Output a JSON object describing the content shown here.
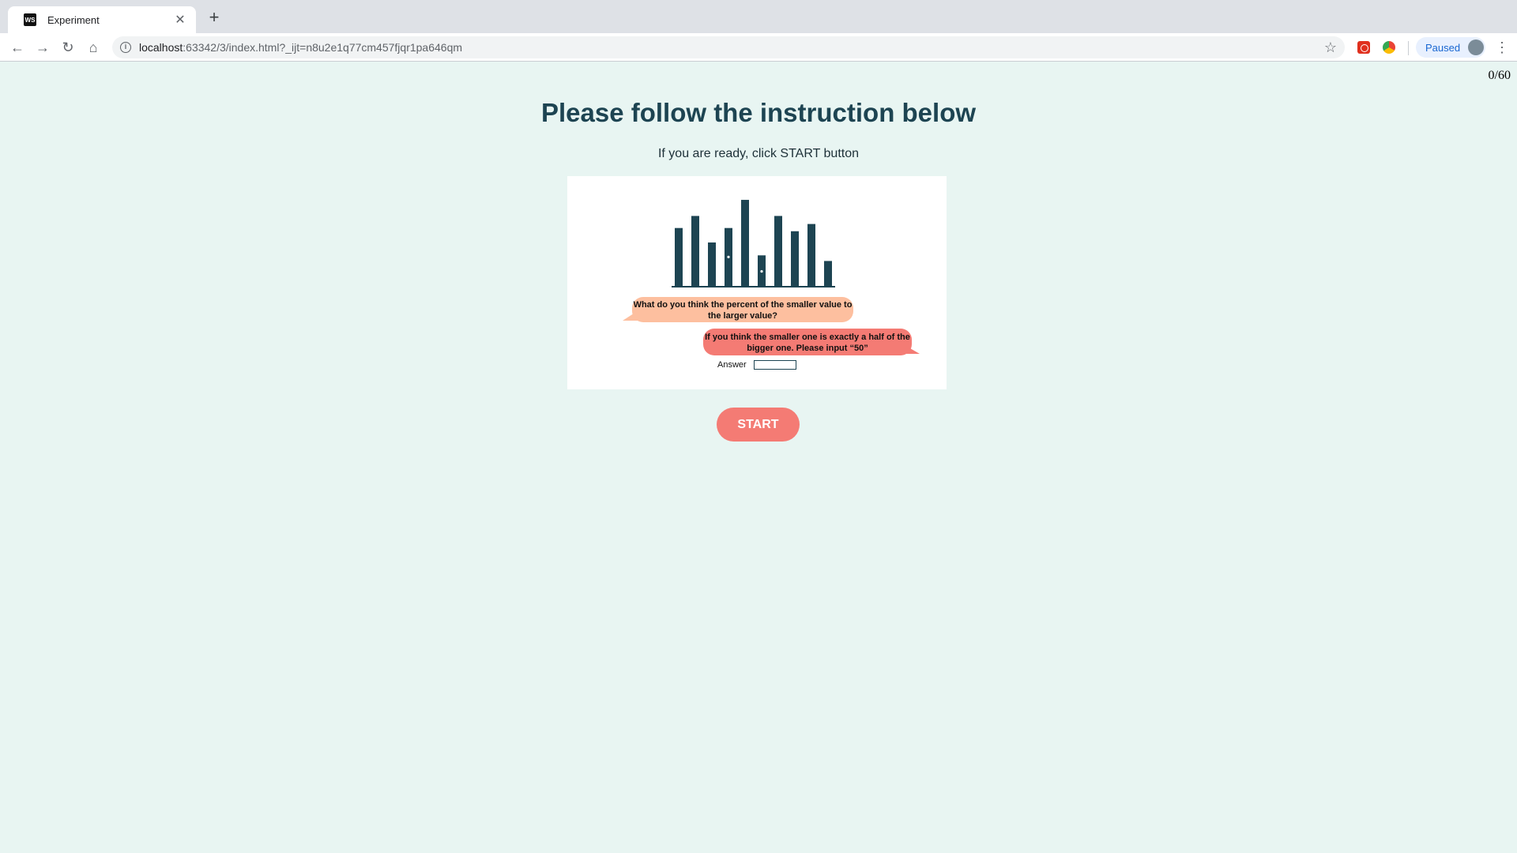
{
  "browser": {
    "tab_title": "Experiment",
    "favicon_text": "WS",
    "close_icon": "close-icon",
    "new_tab_icon": "plus-icon",
    "url_host": "localhost",
    "url_rest": ":63342/3/index.html?_ijt=n8u2e1q77cm457fjqr1pa646qm",
    "profile_status": "Paused"
  },
  "page": {
    "counter": "0/60",
    "title": "Please follow the instruction below",
    "subtitle": "If you are ready, click START button",
    "start_label": "START"
  },
  "instruction": {
    "question": "What do you think the percent of the smaller value to the larger value?",
    "hint": "If you think the smaller one is exactly a half of the bigger one. Please input “50”",
    "answer_label": "Answer",
    "answer_value": ""
  },
  "chart_data": {
    "type": "bar",
    "values": [
      72,
      87,
      54,
      72,
      107,
      38,
      87,
      68,
      77,
      31
    ],
    "marked_indices": [
      3,
      5
    ],
    "colors": {
      "bar": "#1d4452",
      "marker": "#ffffff"
    }
  },
  "colors": {
    "background": "#e8f5f2",
    "title": "#1d4452",
    "start_button": "#f47b74",
    "question_bubble": "#fdbf9f",
    "hint_bubble": "#f47b74"
  }
}
